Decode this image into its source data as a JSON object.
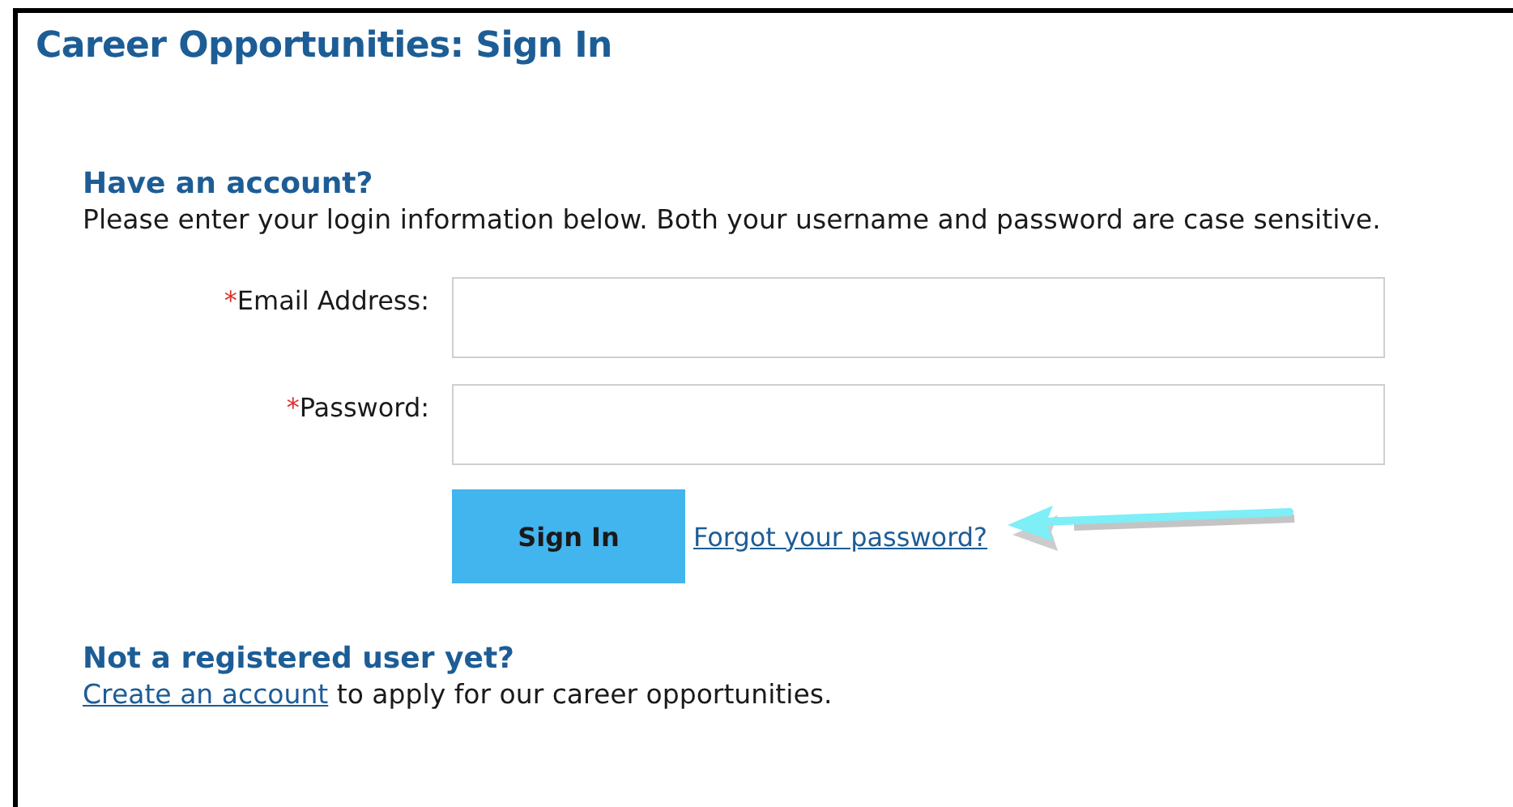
{
  "page": {
    "title": "Career Opportunities: Sign In"
  },
  "login": {
    "heading": "Have an account?",
    "instructions": "Please enter your login information below. Both your username and password are case sensitive.",
    "fields": [
      {
        "required_mark": "*",
        "label": "Email Address:"
      },
      {
        "required_mark": "*",
        "label": "Password:"
      }
    ],
    "submit": "Sign In",
    "forgot_link": "Forgot your password?"
  },
  "register": {
    "heading": "Not a registered user yet?",
    "link": "Create an account",
    "text": " to apply for our career opportunities."
  }
}
